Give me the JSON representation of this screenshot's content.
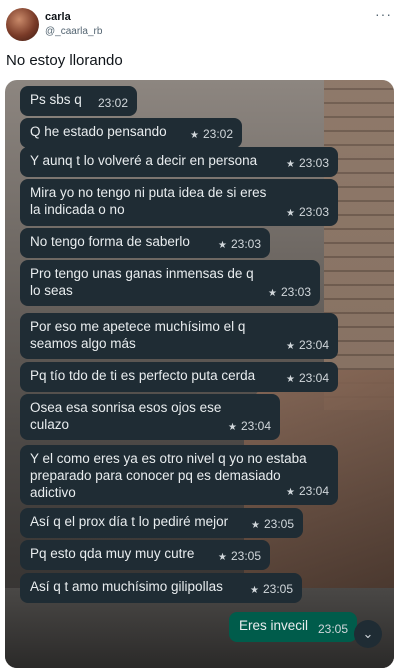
{
  "tweet": {
    "display_name": "carla",
    "handle": "@_caarla_rb",
    "more_label": "···",
    "text": "No estoy llorando"
  },
  "chat": {
    "messages": [
      {
        "text": "Ps sbs q",
        "time": "23:02",
        "starred": false
      },
      {
        "text": "Q he estado pensando",
        "time": "23:02",
        "starred": true
      },
      {
        "text": "Y aunq t lo volveré a decir en persona",
        "time": "23:03",
        "starred": true
      },
      {
        "text": "Mira yo no tengo ni puta idea de si eres la indicada o no",
        "time": "23:03",
        "starred": true
      },
      {
        "text": "No tengo forma de saberlo",
        "time": "23:03",
        "starred": true
      },
      {
        "text": "Pro tengo unas ganas inmensas de q lo seas",
        "time": "23:03",
        "starred": true
      },
      {
        "text": "Por eso me apetece muchísimo el q seamos algo más",
        "time": "23:04",
        "starred": true
      },
      {
        "text": "Pq tío tdo de ti es perfecto puta cerda",
        "time": "23:04",
        "starred": true
      },
      {
        "text": "Osea esa sonrisa esos ojos ese culazo",
        "time": "23:04",
        "starred": true
      },
      {
        "text": "Y el como eres ya es otro nivel q yo no estaba preparado para conocer pq es demasiado adictivo",
        "time": "23:04",
        "starred": true
      },
      {
        "text": "Así q el prox día t lo pediré mejor",
        "time": "23:05",
        "starred": true
      },
      {
        "text": "Pq esto qda muy muy cutre",
        "time": "23:05",
        "starred": true
      },
      {
        "text": "Así q t amo muchísimo gilipollas",
        "time": "23:05",
        "starred": true
      }
    ],
    "reply": {
      "text": "Eres invecil",
      "time": "23:05"
    },
    "star_icon": "★",
    "scroll_icon": "⌄"
  },
  "colors": {
    "incoming": "#1f2c34",
    "outgoing": "#005c4b"
  }
}
